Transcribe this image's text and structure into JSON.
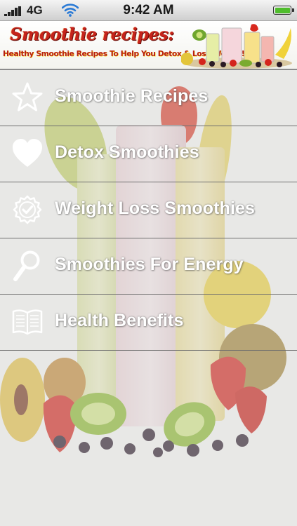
{
  "status_bar": {
    "network": "4G",
    "time": "9:42 AM",
    "signal_bars": 5,
    "battery_level": 1.0,
    "battery_color": "#4fbd2c"
  },
  "banner": {
    "title": "Smoothie recipes:",
    "subtitle": "Healthy Smoothie Recipes To Help You Detox & Lose Weight!",
    "title_color": "#c6231b"
  },
  "menu": {
    "items": [
      {
        "label": "Smoothie Recipes",
        "icon": "star-icon"
      },
      {
        "label": "Detox Smoothies",
        "icon": "heart-icon"
      },
      {
        "label": "Weight Loss Smoothies",
        "icon": "badge-check-icon"
      },
      {
        "label": "Smoothies For Energy",
        "icon": "magnifier-icon"
      },
      {
        "label": "Health Benefits",
        "icon": "open-book-icon"
      }
    ]
  }
}
